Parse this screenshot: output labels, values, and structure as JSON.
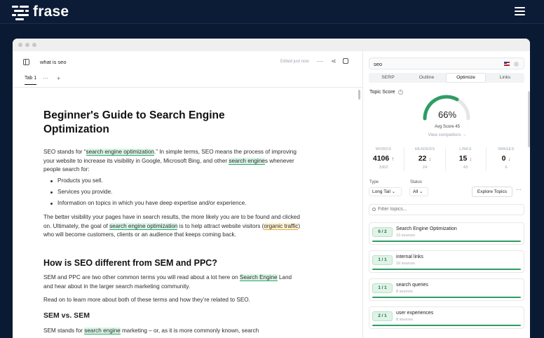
{
  "app": {
    "brand": "frase"
  },
  "doc": {
    "title": "what is seo",
    "status": "Edited just now",
    "tab": "Tab 1",
    "tab_more": "···",
    "tab_add": "+"
  },
  "content": {
    "h1": "Beginner's Guide to Search Engine Optimization",
    "p1": {
      "a": "SEO stands for “",
      "hl1": "search engine optimization",
      "b": ".” In simple terms, SEO means the process of improving your website to increase its visibility in Google, Microsoft Bing, and other ",
      "hl2": "search engine",
      "c": "s whenever people search for:"
    },
    "bullets": [
      "Products you sell.",
      "Services you provide.",
      "Information on topics in which you have deep expertise and/or experience."
    ],
    "p2": {
      "a": "The better visibility your pages have in search results, the more likely you are to be found and clicked on. Ultimately, the goal of ",
      "hl1": "search engine optimization",
      "b": " is to help attract website visitors (",
      "hl2": "organic traffic",
      "c": ") who will become customers, clients or an audience that keeps coming back."
    },
    "h2": "How is SEO different from SEM and PPC?",
    "p3": {
      "a": "SEM and PPC are two other common terms you will read about a lot here on ",
      "hl1": "Search Engine",
      "b": " Land and hear about in the larger search marketing community."
    },
    "p4": "Read on to learn more about both of these terms and how they’re related to SEO.",
    "h3": "SEM vs. SEM",
    "p5": {
      "a": "SEM stands for ",
      "hl1": "search engine",
      "b": " marketing – or, as it is more commonly known, search"
    }
  },
  "panel": {
    "search_query": "seo",
    "tabs": [
      "SERP",
      "Outline",
      "Optimize",
      "Links"
    ],
    "active_tab": "Optimize",
    "topic_score_label": "Topic Score",
    "info_glyph": "i",
    "score": "66%",
    "score_value": 66,
    "avg_score": "Avg Score 45",
    "view_competitors": "View competitors →",
    "metrics": [
      {
        "label": "WORDS",
        "value": "4106",
        "arrow": "↑",
        "trend": "up",
        "sub": "3302"
      },
      {
        "label": "HEADERS",
        "value": "22",
        "arrow": "↓",
        "trend": "down",
        "sub": "24"
      },
      {
        "label": "LINKS",
        "value": "15",
        "arrow": "↓",
        "trend": "down",
        "sub": "43"
      },
      {
        "label": "IMAGES",
        "value": "0",
        "arrow": "↓",
        "trend": "down",
        "sub": "6"
      }
    ],
    "type_label": "Type",
    "type_value": "Long Tail ⌄",
    "status_label": "Status",
    "status_value": "All ⌄",
    "explore_label": "Explore Topics",
    "more_label": "···",
    "filter_placeholder": "Filter topics...",
    "topics": [
      {
        "badge": "6 / 2",
        "name": "Search Engine Optimization",
        "sources": "13 sources",
        "progress": 1.0
      },
      {
        "badge": "1 / 1",
        "name": "internal links",
        "sources": "10 sources",
        "progress": 1.0
      },
      {
        "badge": "1 / 1",
        "name": "search queries",
        "sources": "8 sources",
        "progress": 1.0
      },
      {
        "badge": "2 / 1",
        "name": "user experiences",
        "sources": "8 sources",
        "progress": 1.0
      }
    ]
  },
  "colors": {
    "navy": "#0b1a33",
    "accent_green": "#2f9d63",
    "highlight_green": "#d9f5e6",
    "highlight_yellow": "#fff3d1"
  }
}
